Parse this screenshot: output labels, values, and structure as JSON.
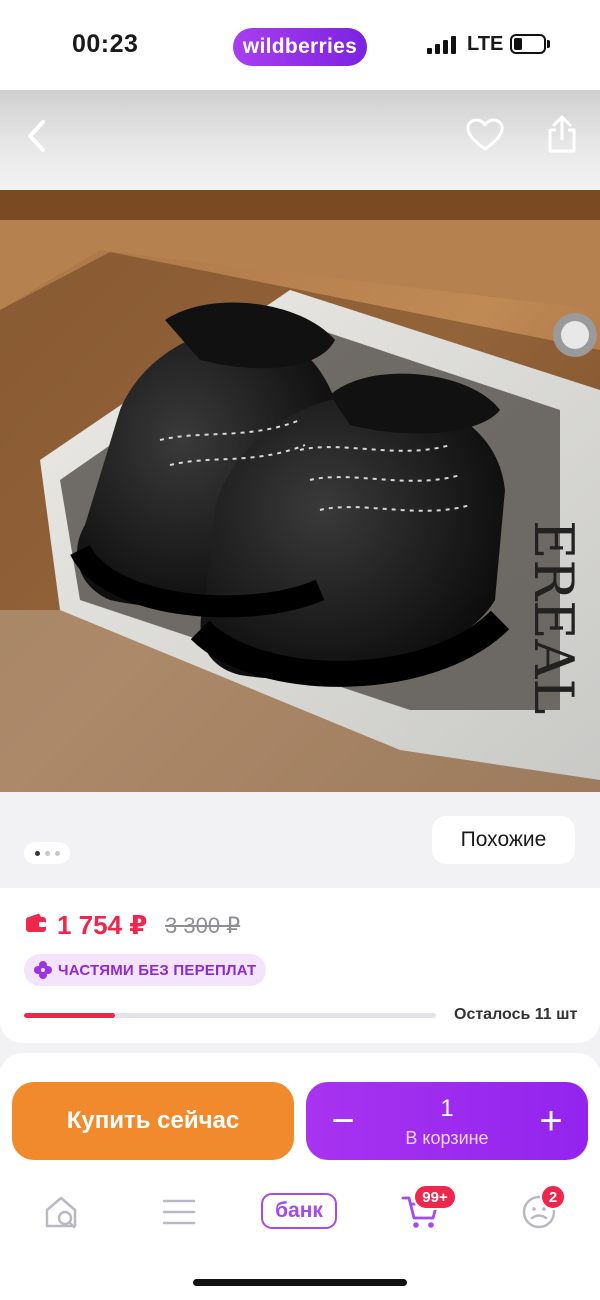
{
  "status_bar": {
    "time": "00:23",
    "brand": "wildberries",
    "network": "LTE",
    "battery_level": 0.3
  },
  "gallery": {
    "similar_label": "Похожие",
    "current_index": 1,
    "total": 3
  },
  "price": {
    "current": "1 754 ₽",
    "old": "3 300 ₽",
    "installments_label": "ЧАСТЯМИ БЕЗ ПЕРЕПЛАТ",
    "stock_label": "Осталось 11 шт",
    "stock_fill": 0.22
  },
  "actions": {
    "buy_now": "Купить сейчас",
    "quantity": "1",
    "in_cart_label": "В корзине",
    "minus": "−",
    "plus": "+"
  },
  "tab_bar": {
    "bank_label": "банк",
    "cart_badge": "99+",
    "profile_badge": "2"
  },
  "colors": {
    "accent_purple": "#9224ee",
    "accent_orange": "#f08a2c",
    "price_red": "#f0264c"
  }
}
